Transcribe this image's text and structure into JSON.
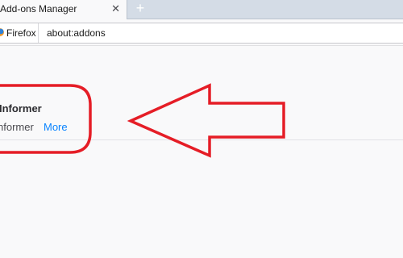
{
  "tab": {
    "title": "Add-ons Manager",
    "close_glyph": "✕"
  },
  "new_tab": {
    "glyph": "+"
  },
  "urlbar": {
    "identity_label": "Firefox",
    "url": "about:addons"
  },
  "addon": {
    "name": "Informer",
    "description": "nformer",
    "more_link": "More"
  },
  "annotation": {
    "color": "#e51d26"
  }
}
